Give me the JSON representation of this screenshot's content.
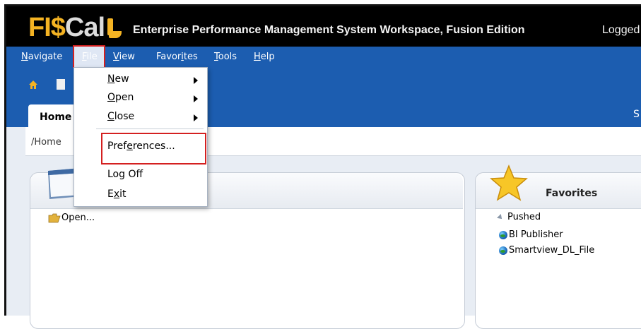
{
  "window": {
    "logo_prefix": "FI$",
    "logo_suffix": "Cal",
    "title": "Enterprise Performance Management System Workspace, Fusion Edition",
    "logged_text": "Logged"
  },
  "menubar": {
    "items": [
      {
        "label": "Navigate",
        "underline_index": 0
      },
      {
        "label": "File",
        "underline_index": 0
      },
      {
        "label": "View",
        "underline_index": 0
      },
      {
        "label": "Favorites",
        "underline_index": 5
      },
      {
        "label": "Tools",
        "underline_index": 0
      },
      {
        "label": "Help",
        "underline_index": 0
      }
    ]
  },
  "file_menu": {
    "items": [
      {
        "label": "New",
        "underline_index": 0,
        "submenu": true
      },
      {
        "label": "Open",
        "underline_index": 0,
        "submenu": true
      },
      {
        "label": "Close",
        "underline_index": 0,
        "submenu": true
      },
      {
        "label": "Preferences...",
        "underline_index": 4,
        "submenu": false
      },
      {
        "label": "Log Off",
        "underline_index": -1,
        "submenu": false
      },
      {
        "label": "Exit",
        "underline_index": 1,
        "submenu": false
      }
    ]
  },
  "tabs": {
    "home_label": "Home",
    "right_char": "S"
  },
  "breadcrumb": "/Home",
  "left_panel": {
    "open_link": "Open..."
  },
  "favorites_panel": {
    "title": "Favorites",
    "tree": [
      {
        "label": "Pushed",
        "icon": "collapse-triangle-icon"
      },
      {
        "label": "BI Publisher",
        "icon": "globe-icon"
      },
      {
        "label": "Smartview_DL_File",
        "icon": "globe-icon"
      }
    ]
  },
  "colors": {
    "menubar_blue": "#1c5db0",
    "logo_gold": "#f4b323",
    "highlight_red": "#d42020"
  }
}
